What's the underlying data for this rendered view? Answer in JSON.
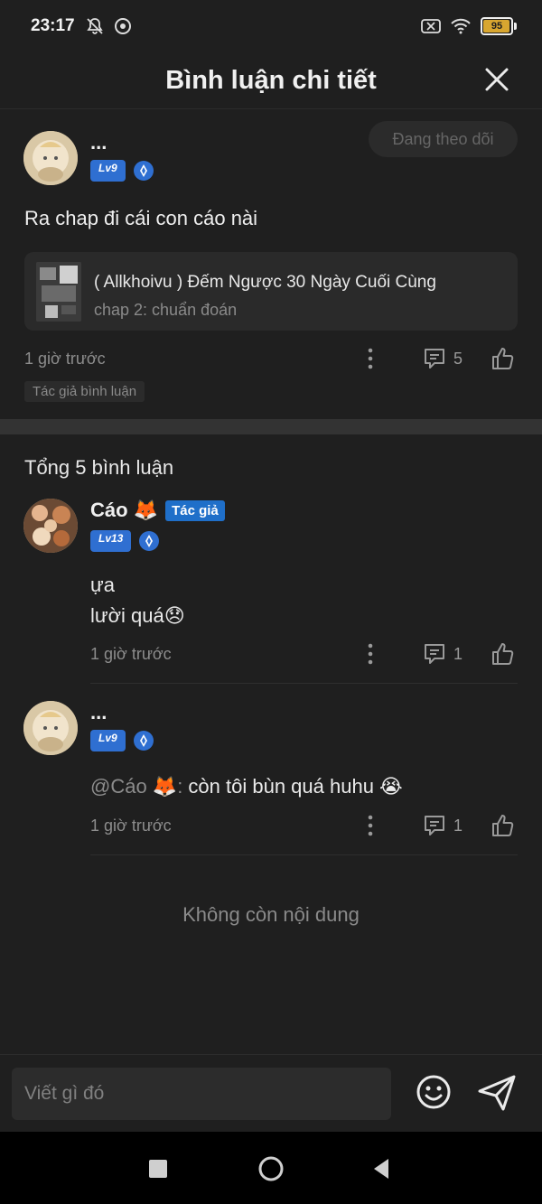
{
  "status_bar": {
    "time": "23:17",
    "battery": "95"
  },
  "header": {
    "title": "Bình luận chi tiết"
  },
  "main_comment": {
    "username": "...",
    "level": "Lv9",
    "follow_label": "Đang theo dõi",
    "text": "Ra chap đi cái con cáo nài",
    "chapter": {
      "title": "( Allkhoivu ) Đếm Ngược 30 Ngày Cuối Cùng",
      "subtitle": "chap 2: chuẩn đoán"
    },
    "time": "1 giờ trước",
    "reply_count": "5",
    "author_tag": "Tác giả bình luận"
  },
  "total_label": "Tổng 5 bình luận",
  "replies": [
    {
      "username": "Cáo 🦊",
      "tag": "Tác giả",
      "level": "Lv13",
      "line1": "ựa",
      "line2": "lười quá😞",
      "time": "1 giờ trước",
      "reply_count": "1"
    },
    {
      "username": "...",
      "level": "Lv9",
      "mention": "@Cáo 🦊:",
      "text": " còn tôi bùn quá huhu 😭",
      "time": "1 giờ trước",
      "reply_count": "1"
    }
  ],
  "end_label": "Không còn nội dung",
  "composer": {
    "placeholder": "Viết gì đó"
  }
}
